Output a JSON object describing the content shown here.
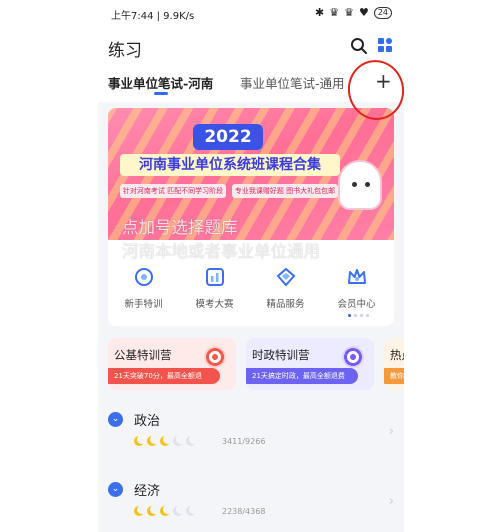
{
  "status_bar": {
    "time_speed": "上午7:44 | 9.9K/s",
    "battery": "24"
  },
  "header": {
    "title": "练习"
  },
  "tabs": [
    {
      "label": "事业单位笔试-河南",
      "active": true
    },
    {
      "label": "事业单位笔试-通用",
      "active": false
    }
  ],
  "add_tab_label": "+",
  "banner": {
    "year": "2022",
    "title": "河南事业单位系统班课程合集",
    "sub1": "针对河南考试 匹配不同学习阶段",
    "sub2": "专业我课赠好题 图书大礼包包邮"
  },
  "overlay_note": {
    "line1": "点加号选择题库",
    "line2": "河南本地或者事业单位通用"
  },
  "shortcuts": [
    {
      "label": "新手特训",
      "icon": "bullseye-icon"
    },
    {
      "label": "模考大赛",
      "icon": "chart-bars-icon"
    },
    {
      "label": "精品服务",
      "icon": "diamond-icon"
    },
    {
      "label": "会员中心",
      "icon": "crown-icon"
    }
  ],
  "promos": [
    {
      "title": "公基特训营",
      "sub": "21天突破70分，最高全额退"
    },
    {
      "title": "时政特训营",
      "sub": "21天搞定时政，最高全额退费"
    },
    {
      "title": "热点",
      "sub": "教你"
    }
  ],
  "sections": [
    {
      "title": "政治",
      "progress": "3411/9266",
      "moons_filled": 3,
      "moons_total": 5
    },
    {
      "title": "经济",
      "progress": "2238/4368",
      "moons_filled": 3,
      "moons_total": 5
    }
  ],
  "colors": {
    "accent": "#2f6df5",
    "annotation_circle": "#e0251c"
  }
}
